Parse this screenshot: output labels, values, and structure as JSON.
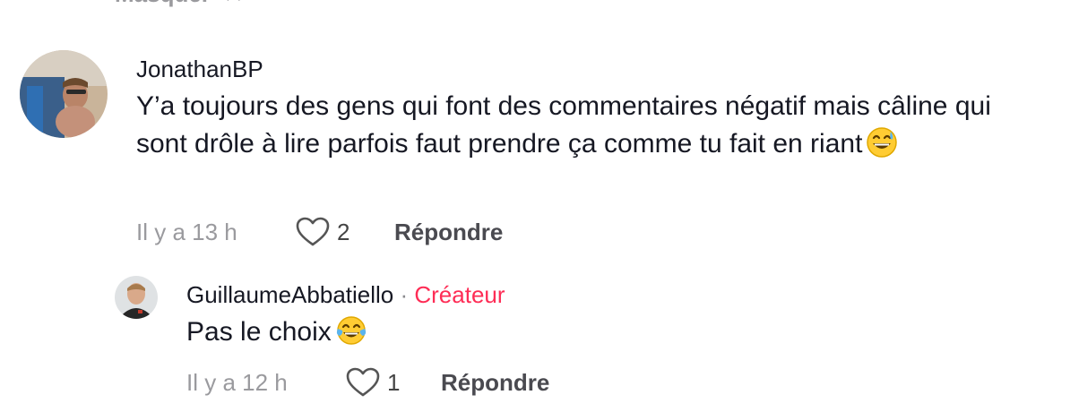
{
  "collapse": {
    "label": "Masquer",
    "icon": "close-icon"
  },
  "comments": [
    {
      "username": "JonathanBP",
      "text": "Y’a toujours des gens qui font des commentaires négatif mais câline qui sont drôle à lire parfois faut prendre ça comme tu fait en riant",
      "emoji": "grinning-face-with-sweat-icon",
      "time": "Il y a 13 h",
      "likes": "2",
      "reply_label": "Répondre"
    }
  ],
  "replies": [
    {
      "username": "GuillaumeAbbatiello",
      "separator": " · ",
      "badge": "Créateur",
      "text": "Pas le choix",
      "emoji": "face-with-tears-of-joy-icon",
      "time": "Il y a 12 h",
      "likes": "1",
      "reply_label": "Répondre"
    }
  ],
  "colors": {
    "creator_badge": "#fe2c55",
    "muted_text": "#9a9a9e",
    "text": "#161823"
  }
}
